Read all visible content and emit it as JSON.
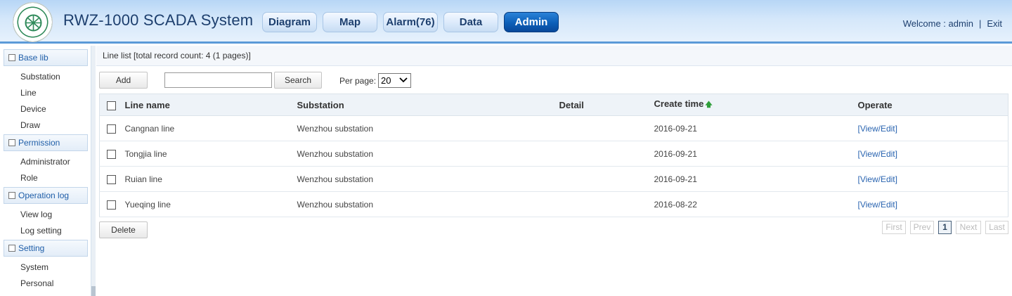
{
  "header": {
    "title": "RWZ-1000 SCADA System",
    "nav": [
      {
        "label": "Diagram",
        "active": false
      },
      {
        "label": "Map",
        "active": false
      },
      {
        "label": "Alarm(76)",
        "active": false
      },
      {
        "label": "Data",
        "active": false
      },
      {
        "label": "Admin",
        "active": true
      }
    ],
    "welcome_label": "Welcome : admin",
    "separator": "|",
    "exit_label": "Exit"
  },
  "sidebar": {
    "groups": [
      {
        "label": "Base lib",
        "items": [
          "Substation",
          "Line",
          "Device",
          "Draw"
        ]
      },
      {
        "label": "Permission",
        "items": [
          "Administrator",
          "Role"
        ]
      },
      {
        "label": "Operation log",
        "items": [
          "View log",
          "Log setting"
        ]
      },
      {
        "label": "Setting",
        "items": [
          "System",
          "Personal"
        ]
      }
    ]
  },
  "main": {
    "caption": "Line list [total record count: 4 (1 pages)]",
    "add_label": "Add",
    "search_value": "",
    "search_label": "Search",
    "per_page_label": "Per page:",
    "per_page_value": "20",
    "columns": [
      "Line name",
      "Substation",
      "Detail",
      "Create time",
      "Operate"
    ],
    "sorted_column": "Create time",
    "rows": [
      {
        "name": "Cangnan line",
        "substation": "Wenzhou substation",
        "detail": "",
        "create_time": "2016-09-21",
        "operate": "[View/Edit]"
      },
      {
        "name": "Tongjia line",
        "substation": "Wenzhou substation",
        "detail": "",
        "create_time": "2016-09-21",
        "operate": "[View/Edit]"
      },
      {
        "name": "Ruian line",
        "substation": "Wenzhou substation",
        "detail": "",
        "create_time": "2016-09-21",
        "operate": "[View/Edit]"
      },
      {
        "name": "Yueqing line",
        "substation": "Wenzhou substation",
        "detail": "",
        "create_time": "2016-08-22",
        "operate": "[View/Edit]"
      }
    ],
    "delete_label": "Delete",
    "pager": {
      "first": "First",
      "prev": "Prev",
      "current": "1",
      "next": "Next",
      "last": "Last"
    }
  },
  "icons": {
    "logo": "company-logo-icon",
    "sort": "sort-ascending-icon",
    "select": "chevron-down-icon"
  },
  "colors": {
    "header_accent": "#5b9ad8",
    "active_nav": "#0c5fb8",
    "link": "#2a64b0",
    "sort_arrow": "#2f9e3a"
  }
}
